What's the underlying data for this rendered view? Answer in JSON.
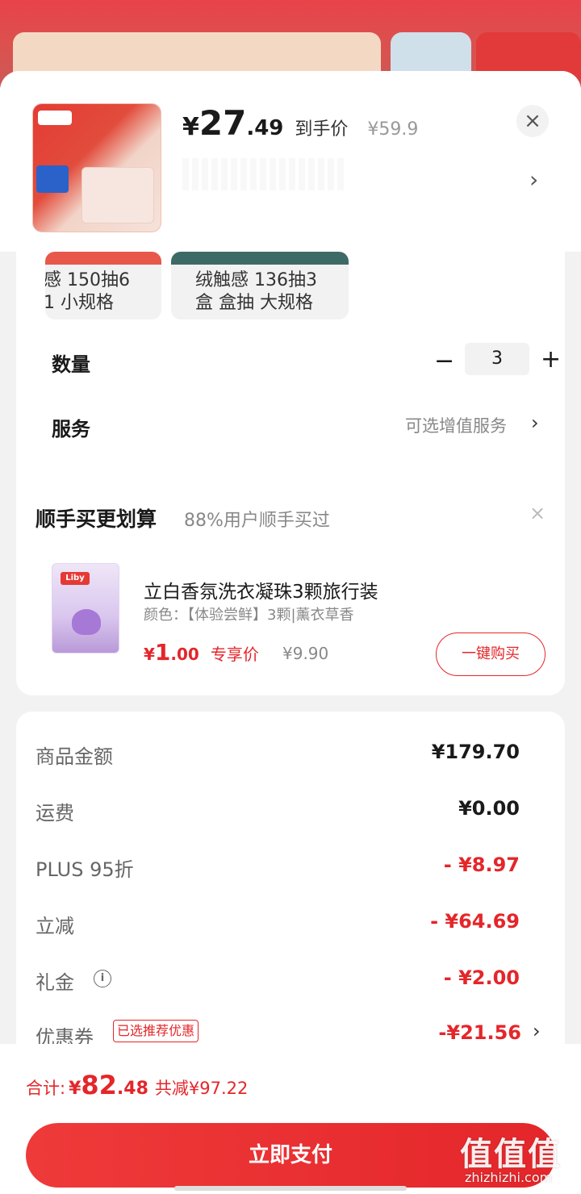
{
  "product": {
    "price_yen": "¥",
    "price_int": "27",
    "price_dec": ".49",
    "price_label": "到手价",
    "original_price": "¥59.9",
    "close_icon": "×",
    "chevron": "›"
  },
  "specs": [
    {
      "label_line1": "感 150抽6",
      "label_line2": "1 小规格"
    },
    {
      "label_line1": "绒触感 136抽3",
      "label_line2": "盒 盒抽 大规格"
    }
  ],
  "quantity": {
    "label": "数量",
    "minus": "−",
    "value": "3",
    "plus": "+"
  },
  "service": {
    "label": "服务",
    "link": "可选增值服务",
    "chevron": "›"
  },
  "addon": {
    "title": "顺手买更划算",
    "subtitle": "88%用户顺手买过",
    "close": "×",
    "logo": "Liby",
    "name": "立白香氛洗衣凝珠3颗旅行装",
    "attr": "颜色：【体验尝鲜】3颗|薰衣草香",
    "price_yen": "¥",
    "price_int": "1",
    "price_dec": ".00",
    "price_label": "专享价",
    "original_price": "¥9.90",
    "buy_button": "一键购买"
  },
  "summary": {
    "rows": [
      {
        "label": "商品金额",
        "value": "¥179.70"
      },
      {
        "label": "运费",
        "value": "¥0.00"
      },
      {
        "label": "PLUS 95折",
        "value": "- ¥8.97"
      },
      {
        "label": "立减",
        "value": "- ¥64.69"
      },
      {
        "label": "礼金",
        "value": "- ¥2.00"
      },
      {
        "label": "优惠券",
        "value": "-¥21.56"
      }
    ],
    "info_icon": "i",
    "coupon_tag": "已选推荐优惠",
    "chevron": "›"
  },
  "footer": {
    "total_label": "合计:",
    "total_yen": "¥",
    "total_int": "82",
    "total_dec": ".48",
    "savings": "共减¥97.22",
    "pay_button": "立即支付"
  },
  "watermark": {
    "big": "值值值",
    "small": "zhizhizhi.com"
  },
  "colors": {
    "accent_red": "#e4262a",
    "text_dark": "#1a1a1a",
    "text_gray": "#888888"
  }
}
